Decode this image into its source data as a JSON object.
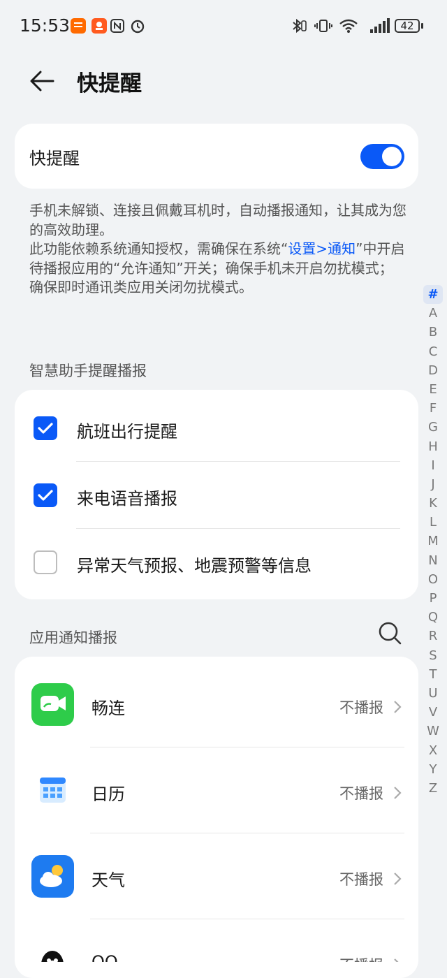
{
  "status_bar": {
    "time": "15:53",
    "battery": "42"
  },
  "header": {
    "title": "快提醒"
  },
  "toggle": {
    "label": "快提醒",
    "on": true
  },
  "description": {
    "line1": "手机未解锁、连接且佩戴耳机时，自动播报通知，让其成为您的高效助理。",
    "line2_pre": "此功能依赖系统通知授权，需确保在系统“",
    "line2_link": "设置>通知",
    "line2_post": "”中开启待播报应用的“允许通知”开关；确保手机未开启勿扰模式；确保即时通讯类应用关闭勿扰模式。"
  },
  "assistant_section": {
    "title": "智慧助手提醒播报",
    "items": [
      {
        "label": "航班出行提醒",
        "checked": true
      },
      {
        "label": "来电语音播报",
        "checked": true
      },
      {
        "label": "异常天气预报、地震预警等信息",
        "checked": false
      }
    ]
  },
  "app_section": {
    "title": "应用通知播报",
    "apps": [
      {
        "name": "畅连",
        "status": "不播报",
        "icon": "meetime-icon"
      },
      {
        "name": "日历",
        "status": "不播报",
        "icon": "calendar-icon"
      },
      {
        "name": "天气",
        "status": "不播报",
        "icon": "weather-icon"
      },
      {
        "name": "QQ",
        "status": "不播报",
        "icon": "qq-icon"
      }
    ]
  },
  "alphabet": [
    "#",
    "A",
    "B",
    "C",
    "D",
    "E",
    "F",
    "G",
    "H",
    "I",
    "J",
    "K",
    "L",
    "M",
    "N",
    "O",
    "P",
    "Q",
    "R",
    "S",
    "T",
    "U",
    "V",
    "W",
    "X",
    "Y",
    "Z"
  ],
  "colors": {
    "accent": "#0a59f7",
    "background": "#f1f3f5"
  }
}
